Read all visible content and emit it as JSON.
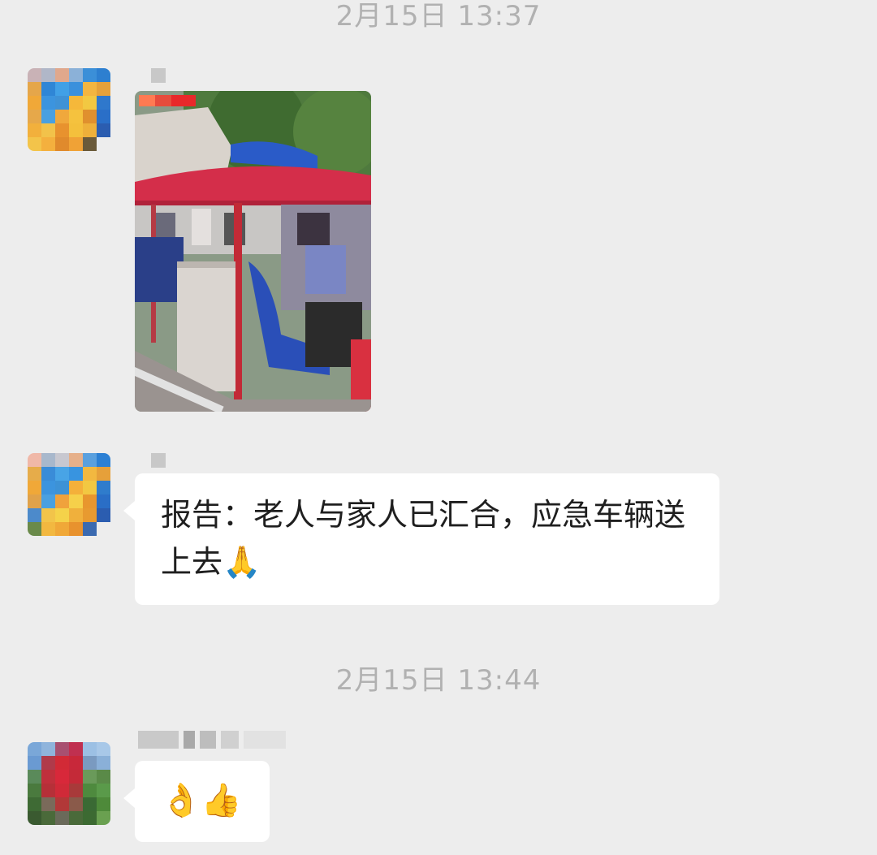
{
  "colors": {
    "background": "#ededed",
    "bubble": "#ffffff",
    "timestamp": "#b1b1b1",
    "text": "#1f1f1f"
  },
  "messages": [
    {
      "type": "timestamp",
      "text": "2月15日 13:37"
    },
    {
      "type": "image",
      "sender_blurred": true,
      "avatar": "pixelated-avatar-blue-yellow",
      "image_desc": "photo-sightseeing-cart"
    },
    {
      "type": "text",
      "sender_blurred": true,
      "avatar": "pixelated-avatar-blue-yellow",
      "text": "报告：老人与家人已汇合，应急车辆送上去",
      "emoji": "🙏"
    },
    {
      "type": "timestamp",
      "text": "2月15日 13:44"
    },
    {
      "type": "text",
      "sender_blurred": true,
      "avatar": "pixelated-avatar-red-green",
      "emoji": "👌👍"
    }
  ]
}
